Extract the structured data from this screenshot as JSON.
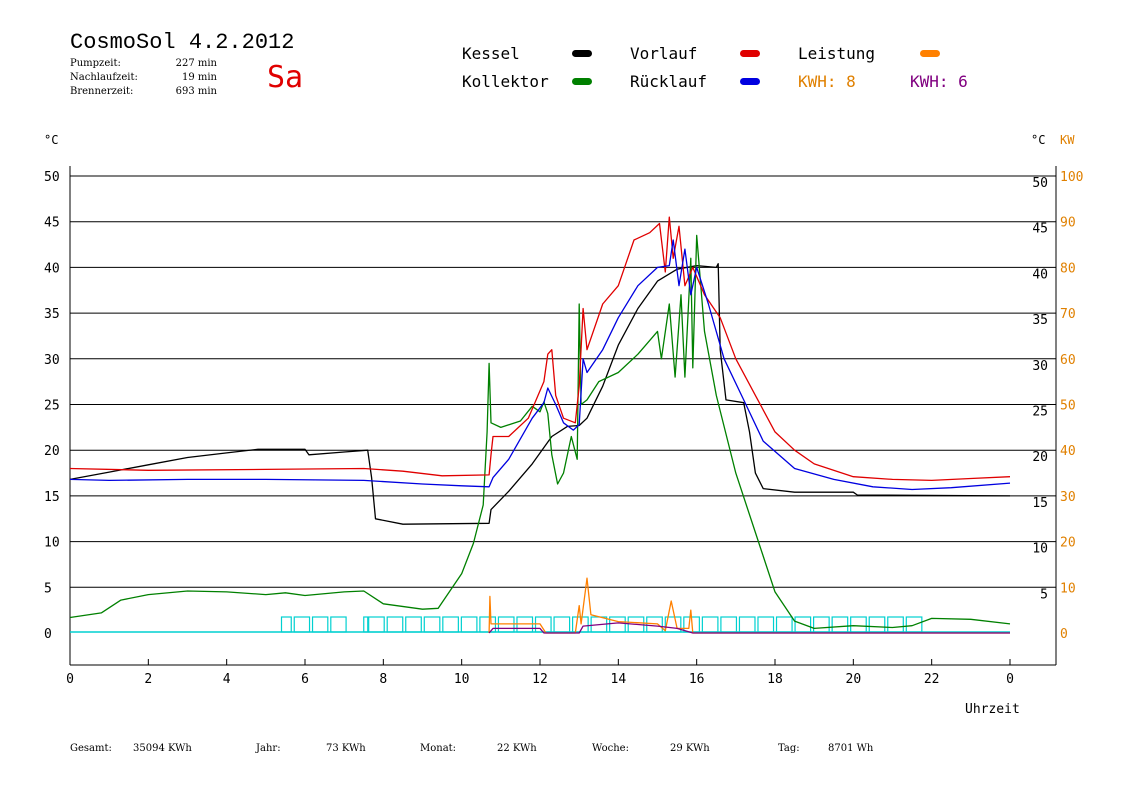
{
  "header": {
    "title": "CosmoSol 4.2.2012",
    "weekday": "Sa",
    "stats": [
      {
        "label": "Pumpzeit:",
        "value": "227 min"
      },
      {
        "label": "Nachlaufzeit:",
        "value": "19 min"
      },
      {
        "label": "Brennerzeit:",
        "value": "693 min"
      }
    ]
  },
  "legend": [
    {
      "label": "Kessel",
      "color": "#000000"
    },
    {
      "label": "Kollektor",
      "color": "#008000"
    },
    {
      "label": "Vorlauf",
      "color": "#e00000"
    },
    {
      "label": "Rücklauf",
      "color": "#0000e0"
    },
    {
      "label": "Leistung",
      "color": "#ff8000"
    }
  ],
  "kwh": [
    {
      "label": "KWH: 8",
      "color": "#e08000"
    },
    {
      "label": "KWH: 6",
      "color": "#800080"
    }
  ],
  "axes": {
    "left_unit": "°C",
    "right_unit_c": "°C",
    "right_unit_kw": "KW",
    "x_label": "Uhrzeit"
  },
  "footer": [
    {
      "label": "Gesamt:",
      "value": "35094 KWh"
    },
    {
      "label": "Jahr:",
      "value": "73 KWh"
    },
    {
      "label": "Monat:",
      "value": "22 KWh"
    },
    {
      "label": "Woche:",
      "value": "29 KWh"
    },
    {
      "label": "Tag:",
      "value": "8701 Wh"
    }
  ],
  "chart_data": {
    "type": "line",
    "title": "CosmoSol 4.2.2012",
    "xlabel": "Uhrzeit",
    "ylabel": "°C",
    "y2label": "KW",
    "xlim": [
      0,
      24
    ],
    "ylim": [
      0,
      50
    ],
    "y2lim": [
      0,
      100
    ],
    "x_ticks": [
      0,
      2,
      4,
      6,
      8,
      10,
      12,
      14,
      16,
      18,
      20,
      22,
      0
    ],
    "y_ticks": [
      0,
      5,
      10,
      15,
      20,
      25,
      30,
      35,
      40,
      45,
      50
    ],
    "y2_c_ticks": [
      5,
      10,
      15,
      20,
      25,
      30,
      35,
      40,
      45,
      50
    ],
    "y2_kw_ticks": [
      0,
      10,
      20,
      30,
      40,
      50,
      60,
      70,
      80,
      90,
      100
    ],
    "grid": true,
    "series": [
      {
        "name": "Kessel",
        "color": "#000000",
        "points": [
          [
            0,
            16.8
          ],
          [
            1,
            17.6
          ],
          [
            2,
            18.4
          ],
          [
            3,
            19.2
          ],
          [
            4,
            19.7
          ],
          [
            4.8,
            20.1
          ],
          [
            6,
            20.1
          ],
          [
            6.1,
            19.5
          ],
          [
            7,
            19.8
          ],
          [
            7.6,
            20.0
          ],
          [
            7.7,
            17
          ],
          [
            7.8,
            12.5
          ],
          [
            8.5,
            11.9
          ],
          [
            10.7,
            12.0
          ],
          [
            10.75,
            13.5
          ],
          [
            11.2,
            15.5
          ],
          [
            11.8,
            18.5
          ],
          [
            12.3,
            21.5
          ],
          [
            12.7,
            22.6
          ],
          [
            13,
            22.7
          ],
          [
            13.2,
            23.5
          ],
          [
            13.6,
            27
          ],
          [
            14.0,
            31.5
          ],
          [
            14.5,
            35.5
          ],
          [
            15,
            38.5
          ],
          [
            15.5,
            39.8
          ],
          [
            16,
            40.2
          ],
          [
            16.5,
            40.0
          ],
          [
            16.55,
            40.4
          ],
          [
            16.6,
            31
          ],
          [
            16.75,
            25.5
          ],
          [
            17.2,
            25.2
          ],
          [
            17.35,
            22
          ],
          [
            17.5,
            17.5
          ],
          [
            17.7,
            15.8
          ],
          [
            18.5,
            15.4
          ],
          [
            20,
            15.4
          ],
          [
            20.1,
            15.1
          ],
          [
            24,
            15.0
          ]
        ]
      },
      {
        "name": "Kollektor",
        "color": "#008000",
        "points": [
          [
            0,
            1.7
          ],
          [
            0.8,
            2.2
          ],
          [
            1.3,
            3.6
          ],
          [
            2,
            4.2
          ],
          [
            3,
            4.6
          ],
          [
            4,
            4.5
          ],
          [
            5,
            4.2
          ],
          [
            5.5,
            4.4
          ],
          [
            6,
            4.1
          ],
          [
            7,
            4.5
          ],
          [
            7.5,
            4.6
          ],
          [
            8,
            3.2
          ],
          [
            9,
            2.6
          ],
          [
            9.4,
            2.7
          ],
          [
            10,
            6.5
          ],
          [
            10.3,
            9.8
          ],
          [
            10.55,
            14
          ],
          [
            10.65,
            22
          ],
          [
            10.7,
            29.5
          ],
          [
            10.75,
            23
          ],
          [
            11,
            22.5
          ],
          [
            11.5,
            23.2
          ],
          [
            11.8,
            24.8
          ],
          [
            12,
            24.2
          ],
          [
            12.1,
            25.3
          ],
          [
            12.2,
            24.0
          ],
          [
            12.3,
            19.5
          ],
          [
            12.45,
            16.3
          ],
          [
            12.6,
            17.5
          ],
          [
            12.8,
            21.5
          ],
          [
            12.95,
            19
          ],
          [
            13,
            36
          ],
          [
            13.05,
            25
          ],
          [
            13.2,
            25.5
          ],
          [
            13.5,
            27.5
          ],
          [
            14,
            28.5
          ],
          [
            14.5,
            30.5
          ],
          [
            15,
            33
          ],
          [
            15.1,
            30
          ],
          [
            15.3,
            36
          ],
          [
            15.45,
            28
          ],
          [
            15.6,
            37
          ],
          [
            15.7,
            28
          ],
          [
            15.85,
            41
          ],
          [
            15.9,
            29
          ],
          [
            16,
            43.5
          ],
          [
            16.2,
            33
          ],
          [
            16.5,
            26
          ],
          [
            17,
            17.5
          ],
          [
            17.5,
            11
          ],
          [
            18,
            4.5
          ],
          [
            18.5,
            1.3
          ],
          [
            19,
            0.5
          ],
          [
            20,
            0.8
          ],
          [
            21,
            0.6
          ],
          [
            21.5,
            0.8
          ],
          [
            22,
            1.6
          ],
          [
            23,
            1.5
          ],
          [
            24,
            1.0
          ]
        ]
      },
      {
        "name": "Vorlauf",
        "color": "#e00000",
        "points": [
          [
            0,
            18.0
          ],
          [
            2,
            17.8
          ],
          [
            5,
            17.9
          ],
          [
            7.5,
            18.0
          ],
          [
            8.5,
            17.7
          ],
          [
            9.5,
            17.2
          ],
          [
            10.7,
            17.3
          ],
          [
            10.75,
            19.5
          ],
          [
            10.8,
            21.5
          ],
          [
            11.2,
            21.5
          ],
          [
            11.7,
            23.5
          ],
          [
            12.1,
            27.5
          ],
          [
            12.2,
            30.5
          ],
          [
            12.3,
            31.0
          ],
          [
            12.4,
            26
          ],
          [
            12.6,
            23.5
          ],
          [
            12.9,
            23.0
          ],
          [
            13,
            27
          ],
          [
            13.1,
            35.5
          ],
          [
            13.2,
            31
          ],
          [
            13.6,
            36
          ],
          [
            14,
            38
          ],
          [
            14.4,
            43
          ],
          [
            14.8,
            43.8
          ],
          [
            15.05,
            44.8
          ],
          [
            15.2,
            39.5
          ],
          [
            15.3,
            45.5
          ],
          [
            15.4,
            41
          ],
          [
            15.55,
            44.5
          ],
          [
            15.7,
            38
          ],
          [
            15.9,
            40
          ],
          [
            16.2,
            37
          ],
          [
            16.6,
            34.5
          ],
          [
            17,
            30
          ],
          [
            17.5,
            26
          ],
          [
            18,
            22
          ],
          [
            18.5,
            20
          ],
          [
            19,
            18.5
          ],
          [
            20,
            17.1
          ],
          [
            21,
            16.8
          ],
          [
            22,
            16.7
          ],
          [
            23,
            16.9
          ],
          [
            24,
            17.1
          ]
        ]
      },
      {
        "name": "Rücklauf",
        "color": "#0000e0",
        "points": [
          [
            0,
            16.8
          ],
          [
            1,
            16.7
          ],
          [
            3,
            16.8
          ],
          [
            5,
            16.8
          ],
          [
            7.5,
            16.7
          ],
          [
            9,
            16.3
          ],
          [
            10,
            16.1
          ],
          [
            10.7,
            16.0
          ],
          [
            10.8,
            17
          ],
          [
            11.2,
            19
          ],
          [
            11.8,
            23.5
          ],
          [
            12.1,
            25.2
          ],
          [
            12.2,
            26.8
          ],
          [
            12.4,
            25
          ],
          [
            12.6,
            23
          ],
          [
            12.85,
            22.2
          ],
          [
            13,
            22.8
          ],
          [
            13.1,
            30
          ],
          [
            13.2,
            28.5
          ],
          [
            13.6,
            31
          ],
          [
            14,
            34.5
          ],
          [
            14.5,
            38
          ],
          [
            15,
            40
          ],
          [
            15.3,
            40.2
          ],
          [
            15.4,
            43
          ],
          [
            15.55,
            38
          ],
          [
            15.7,
            42
          ],
          [
            15.85,
            37
          ],
          [
            16.0,
            40
          ],
          [
            16.3,
            36
          ],
          [
            16.7,
            30
          ],
          [
            17.2,
            25.5
          ],
          [
            17.7,
            21
          ],
          [
            18.5,
            18
          ],
          [
            19.5,
            16.8
          ],
          [
            20.5,
            16.0
          ],
          [
            21.5,
            15.7
          ],
          [
            22.5,
            15.9
          ],
          [
            24,
            16.4
          ]
        ]
      },
      {
        "name": "Leistung",
        "color": "#ff8000",
        "axis": "kw",
        "points": [
          [
            10.7,
            0
          ],
          [
            10.72,
            8
          ],
          [
            10.75,
            2
          ],
          [
            11,
            2
          ],
          [
            12,
            2
          ],
          [
            12.15,
            0
          ],
          [
            12.9,
            0
          ],
          [
            13.0,
            6
          ],
          [
            13.05,
            2
          ],
          [
            13.2,
            12
          ],
          [
            13.3,
            4
          ],
          [
            14,
            2.5
          ],
          [
            15,
            2
          ],
          [
            15.2,
            0.5
          ],
          [
            15.35,
            7
          ],
          [
            15.5,
            1
          ],
          [
            15.8,
            1
          ],
          [
            15.85,
            5
          ],
          [
            15.9,
            0
          ],
          [
            24,
            0
          ]
        ]
      },
      {
        "name": "KWH purple",
        "color": "#800080",
        "axis": "kw",
        "points": [
          [
            10.7,
            0
          ],
          [
            10.8,
            1
          ],
          [
            12,
            1
          ],
          [
            12.1,
            0
          ],
          [
            13.0,
            0
          ],
          [
            13.1,
            1.5
          ],
          [
            14,
            2.2
          ],
          [
            15,
            1.5
          ],
          [
            15.5,
            1
          ],
          [
            15.9,
            0
          ],
          [
            24,
            0
          ]
        ]
      }
    ],
    "pump_markers": {
      "color": "#00d0d0",
      "x_ranges": [
        [
          5.4,
          5.7
        ],
        [
          5.7,
          7.1
        ],
        [
          7.5,
          7.6
        ],
        [
          7.6,
          21.8
        ]
      ]
    }
  }
}
